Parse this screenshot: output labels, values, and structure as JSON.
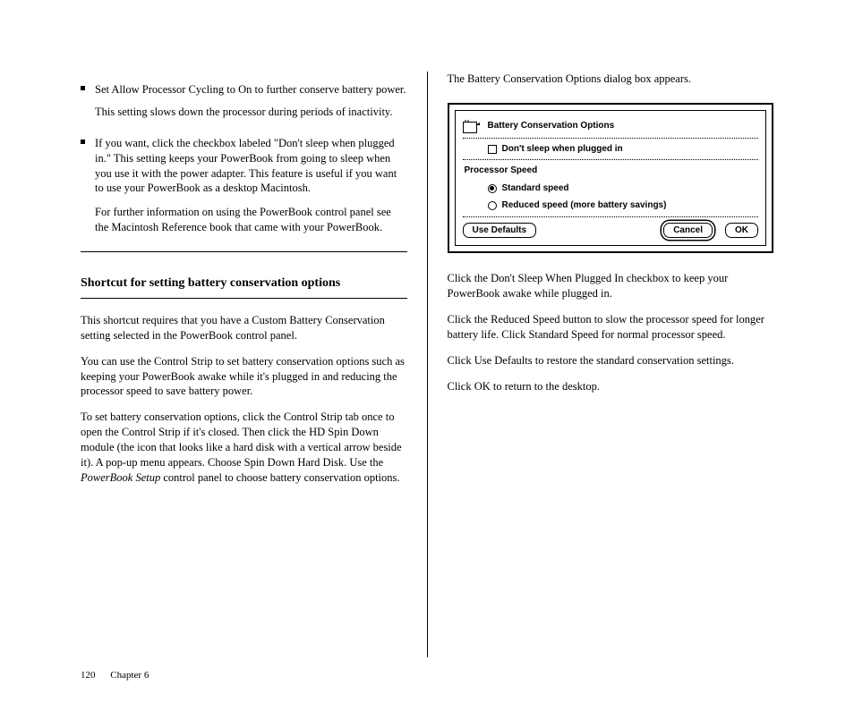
{
  "left": {
    "bullet1": "Set Allow Processor Cycling to On to further conserve battery power.",
    "bullet1_cont": "This setting slows down the processor during periods of inactivity.",
    "bullet2": "If you want, click the checkbox labeled \"Don't sleep when plugged in.\" This setting keeps your PowerBook from going to sleep when you use it with the power adapter. This feature is useful if you want to use your PowerBook as a desktop Macintosh.",
    "bullet2_cont": "For further information on using the PowerBook control panel see the Macintosh Reference book that came with your PowerBook.",
    "section_heading": "Shortcut for setting battery conservation options",
    "p1": "This shortcut requires that you have a Custom Battery Conservation setting selected in the PowerBook control panel.",
    "p2": "You can use the Control Strip to set battery conservation options such as keeping your PowerBook awake while it's plugged in and reducing the processor speed to save battery power.",
    "p3a": "To set battery conservation options, click the Control Strip tab once to open the Control Strip if it's closed. Then click the HD Spin Down module (the icon that looks like a hard disk with a vertical arrow beside it). A pop-up menu appears. Choose Spin Down Hard Disk. Use the ",
    "p3b": "PowerBook Setup",
    "p3c": " control panel to choose battery conservation options."
  },
  "right": {
    "intro": "The Battery Conservation Options dialog box appears.",
    "after1": "Click the Don't Sleep When Plugged In checkbox to keep your PowerBook awake while plugged in.",
    "after2": "Click the Reduced Speed button to slow the processor speed for longer battery life. Click Standard Speed for normal processor speed.",
    "after3": "Click Use Defaults to restore the standard conservation settings.",
    "after4": "Click OK to return to the desktop."
  },
  "dialog": {
    "title": "Battery Conservation Options",
    "sleep_checkbox": "Don't sleep when plugged in",
    "proc_heading": "Processor Speed",
    "radio1": "Standard speed",
    "radio2": "Reduced speed (more battery savings)",
    "use_defaults": "Use Defaults",
    "cancel": "Cancel",
    "ok": "OK"
  },
  "footer": {
    "page": "120",
    "chapter": "Chapter 6"
  }
}
